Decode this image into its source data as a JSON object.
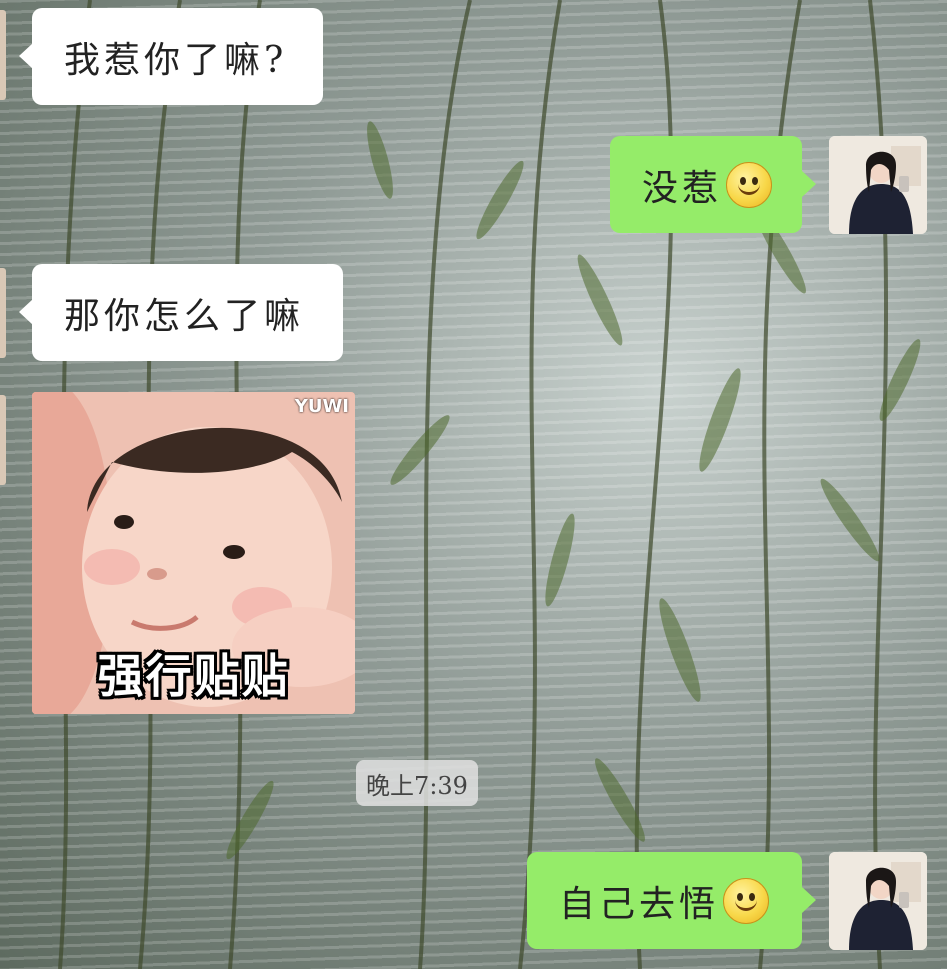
{
  "messages": {
    "m1": {
      "text": "我惹你了嘛?"
    },
    "m2": {
      "text": "没惹",
      "emoji": "smile-emoji"
    },
    "m3": {
      "text": "那你怎么了嘛"
    },
    "sticker": {
      "caption": "强行贴贴",
      "tag": "YUWI"
    },
    "timestamp": "晚上7:39",
    "m4": {
      "text": "自己去悟",
      "emoji": "smile-emoji"
    }
  },
  "colors": {
    "incoming_bubble": "#ffffff",
    "outgoing_bubble": "#95ec69",
    "timestamp_bg": "#e1e1e1"
  }
}
